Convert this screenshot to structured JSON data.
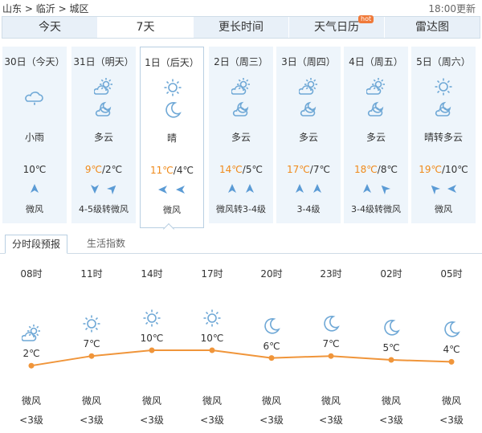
{
  "breadcrumb": [
    "山东",
    "临沂",
    "城区"
  ],
  "breadcrumb_sep": ">",
  "updated": "18:00更新",
  "tabs": [
    {
      "label": "今天"
    },
    {
      "label": "7天"
    },
    {
      "label": "更长时间"
    },
    {
      "label": "天气日历",
      "badge": "hot"
    },
    {
      "label": "雷达图"
    }
  ],
  "days": [
    {
      "date": "30日（今天）",
      "icon1": "rain-cloud",
      "icon2": "",
      "cond": "小雨",
      "hi": "",
      "lo": "10℃",
      "winds": [
        "north"
      ],
      "wind": "微风"
    },
    {
      "date": "31日（明天）",
      "icon1": "partly-cloudy",
      "icon2": "cloud-moon",
      "cond": "多云",
      "hi": "9℃",
      "lo": "2℃",
      "winds": [
        "south",
        "northeast"
      ],
      "wind": "4-5级转微风"
    },
    {
      "date": "1日（后天）",
      "icon1": "sun",
      "icon2": "moon",
      "cond": "晴",
      "hi": "11℃",
      "lo": "4℃",
      "winds": [
        "west",
        "west"
      ],
      "wind": "微风"
    },
    {
      "date": "2日（周三）",
      "icon1": "partly-cloudy",
      "icon2": "cloud-moon",
      "cond": "多云",
      "hi": "14℃",
      "lo": "5℃",
      "winds": [
        "north",
        "north"
      ],
      "wind": "微风转3-4级"
    },
    {
      "date": "3日（周四）",
      "icon1": "partly-cloudy",
      "icon2": "cloud-moon",
      "cond": "多云",
      "hi": "17℃",
      "lo": "7℃",
      "winds": [
        "north",
        "north"
      ],
      "wind": "3-4级"
    },
    {
      "date": "4日（周五）",
      "icon1": "partly-cloudy",
      "icon2": "cloud-moon",
      "cond": "多云",
      "hi": "18℃",
      "lo": "8℃",
      "winds": [
        "north",
        "northwest"
      ],
      "wind": "3-4级转微风"
    },
    {
      "date": "5日（周六）",
      "icon1": "sun",
      "icon2": "cloud-moon",
      "cond": "晴转多云",
      "hi": "19℃",
      "lo": "10℃",
      "winds": [
        "northwest",
        "west"
      ],
      "wind": "微风"
    }
  ],
  "subtabs": [
    "分时段预报",
    "生活指数"
  ],
  "hourly": [
    {
      "time": "08时",
      "icon": "partly-cloudy",
      "temp": 2,
      "temp_label": "2℃",
      "wind": "微风",
      "level": "<3级"
    },
    {
      "time": "11时",
      "icon": "sun",
      "temp": 7,
      "temp_label": "7℃",
      "wind": "微风",
      "level": "<3级"
    },
    {
      "time": "14时",
      "icon": "sun",
      "temp": 10,
      "temp_label": "10℃",
      "wind": "微风",
      "level": "<3级"
    },
    {
      "time": "17时",
      "icon": "sun",
      "temp": 10,
      "temp_label": "10℃",
      "wind": "微风",
      "level": "<3级"
    },
    {
      "time": "20时",
      "icon": "moon",
      "temp": 6,
      "temp_label": "6℃",
      "wind": "微风",
      "level": "<3级"
    },
    {
      "time": "23时",
      "icon": "moon",
      "temp": 7,
      "temp_label": "7℃",
      "wind": "微风",
      "level": "<3级"
    },
    {
      "time": "02时",
      "icon": "moon",
      "temp": 5,
      "temp_label": "5℃",
      "wind": "微风",
      "level": "<3级"
    },
    {
      "time": "05时",
      "icon": "moon",
      "temp": 4,
      "temp_label": "4℃",
      "wind": "微风",
      "level": "<3级"
    }
  ],
  "colors": {
    "accent": "#f08a1a",
    "line": "#f0953a",
    "icon": "#6fa8d6",
    "wind_arrow": "#5b9bd5"
  }
}
